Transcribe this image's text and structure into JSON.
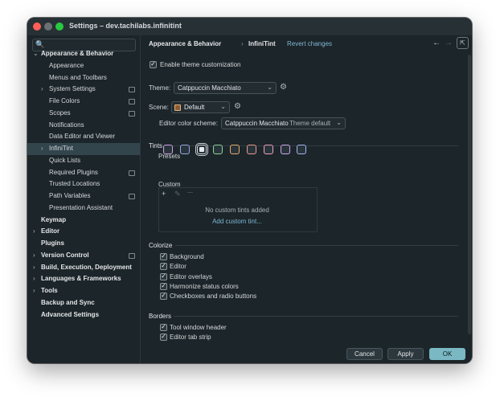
{
  "window": {
    "title": "Settings – dev.tachilabs.infinitint"
  },
  "sidebar": {
    "items": [
      {
        "label": "Appearance & Behavior",
        "level": 0,
        "bold": true,
        "chevron": "⌄",
        "page_icon": false,
        "selected": false
      },
      {
        "label": "Appearance",
        "level": 1,
        "bold": false,
        "chevron": "",
        "page_icon": false,
        "selected": false
      },
      {
        "label": "Menus and Toolbars",
        "level": 1,
        "bold": false,
        "chevron": "",
        "page_icon": false,
        "selected": false
      },
      {
        "label": "System Settings",
        "level": 1,
        "bold": false,
        "chevron": "›",
        "page_icon": true,
        "selected": false
      },
      {
        "label": "File Colors",
        "level": 1,
        "bold": false,
        "chevron": "",
        "page_icon": true,
        "selected": false
      },
      {
        "label": "Scopes",
        "level": 1,
        "bold": false,
        "chevron": "",
        "page_icon": true,
        "selected": false
      },
      {
        "label": "Notifications",
        "level": 1,
        "bold": false,
        "chevron": "",
        "page_icon": false,
        "selected": false
      },
      {
        "label": "Data Editor and Viewer",
        "level": 1,
        "bold": false,
        "chevron": "",
        "page_icon": false,
        "selected": false
      },
      {
        "label": "InfiniTint",
        "level": 1,
        "bold": false,
        "chevron": "›",
        "page_icon": false,
        "selected": true
      },
      {
        "label": "Quick Lists",
        "level": 1,
        "bold": false,
        "chevron": "",
        "page_icon": false,
        "selected": false
      },
      {
        "label": "Required Plugins",
        "level": 1,
        "bold": false,
        "chevron": "",
        "page_icon": true,
        "selected": false
      },
      {
        "label": "Trusted Locations",
        "level": 1,
        "bold": false,
        "chevron": "",
        "page_icon": false,
        "selected": false
      },
      {
        "label": "Path Variables",
        "level": 1,
        "bold": false,
        "chevron": "",
        "page_icon": true,
        "selected": false
      },
      {
        "label": "Presentation Assistant",
        "level": 1,
        "bold": false,
        "chevron": "",
        "page_icon": false,
        "selected": false
      },
      {
        "label": "Keymap",
        "level": 0,
        "bold": true,
        "chevron": "",
        "page_icon": false,
        "selected": false
      },
      {
        "label": "Editor",
        "level": 0,
        "bold": true,
        "chevron": "›",
        "page_icon": false,
        "selected": false
      },
      {
        "label": "Plugins",
        "level": 0,
        "bold": true,
        "chevron": "",
        "page_icon": false,
        "selected": false
      },
      {
        "label": "Version Control",
        "level": 0,
        "bold": true,
        "chevron": "›",
        "page_icon": true,
        "selected": false
      },
      {
        "label": "Build, Execution, Deployment",
        "level": 0,
        "bold": true,
        "chevron": "›",
        "page_icon": false,
        "selected": false
      },
      {
        "label": "Languages & Frameworks",
        "level": 0,
        "bold": true,
        "chevron": "›",
        "page_icon": false,
        "selected": false
      },
      {
        "label": "Tools",
        "level": 0,
        "bold": true,
        "chevron": "›",
        "page_icon": false,
        "selected": false
      },
      {
        "label": "Backup and Sync",
        "level": 0,
        "bold": true,
        "chevron": "",
        "page_icon": false,
        "selected": false
      },
      {
        "label": "Advanced Settings",
        "level": 0,
        "bold": true,
        "chevron": "",
        "page_icon": false,
        "selected": false
      }
    ]
  },
  "header": {
    "breadcrumb_parent": "Appearance & Behavior",
    "breadcrumb_separator": "›",
    "breadcrumb_current": "InfiniTint",
    "revert_link": "Revert changes"
  },
  "content": {
    "enable_label": "Enable theme customization",
    "theme_label": "Theme:",
    "theme_value": "Catppuccin Macchiato",
    "scene_label": "Scene:",
    "scene_value": "Default",
    "editor_scheme_label": "Editor color scheme:",
    "editor_scheme_value": "Catppuccin Macchiato",
    "editor_scheme_sub": "Theme default",
    "tints_section": "Tints",
    "presets_label": "Presets",
    "presets": [
      {
        "border": "#cfa3e8",
        "selected": false
      },
      {
        "border": "#98a8e6",
        "selected": false
      },
      {
        "border": "#cfd6da",
        "selected": true
      },
      {
        "border": "#8fd19a",
        "selected": false
      },
      {
        "border": "#e9a86a",
        "selected": false
      },
      {
        "border": "#ec9a8e",
        "selected": false
      },
      {
        "border": "#f0a1c2",
        "selected": false
      },
      {
        "border": "#d3a7ef",
        "selected": false
      },
      {
        "border": "#a5b3f0",
        "selected": false
      }
    ],
    "custom_label": "Custom",
    "custom_empty": "No custom tints added",
    "custom_add": "Add custom tint...",
    "colorize_section": "Colorize",
    "colorize_items": [
      "Background",
      "Editor",
      "Editor overlays",
      "Harmonize status colors",
      "Checkboxes and radio buttons"
    ],
    "borders_section": "Borders",
    "borders_items": [
      "Tool window header",
      "Editor tab strip"
    ]
  },
  "footer": {
    "cancel": "Cancel",
    "apply": "Apply",
    "ok": "OK"
  },
  "icons": {
    "search": "🔍",
    "chevron_down": "⌄",
    "gear": "⚙",
    "back": "←",
    "forward": "→",
    "pin": "⇱",
    "add": "+",
    "edit": "✎",
    "remove": "—",
    "help": "?",
    "check": "✓"
  }
}
